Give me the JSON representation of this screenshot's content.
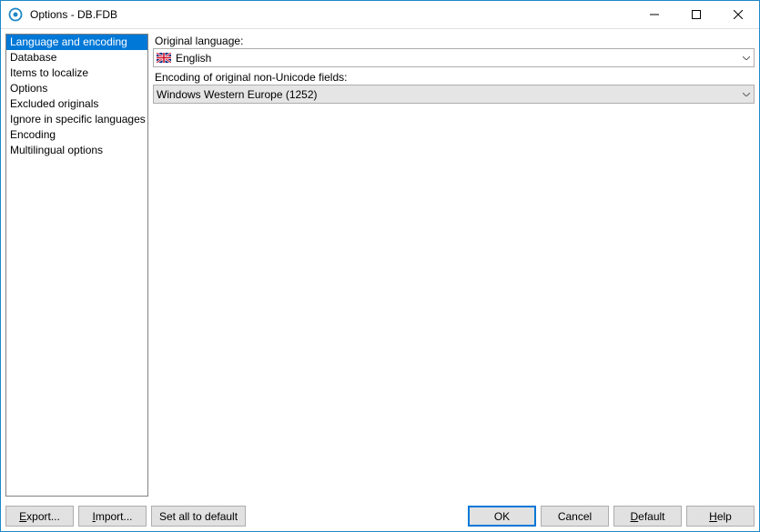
{
  "titlebar": {
    "title": "Options - DB.FDB"
  },
  "sidebar": {
    "items": [
      {
        "label": "Language and encoding",
        "selected": true
      },
      {
        "label": "Database"
      },
      {
        "label": "Items to localize"
      },
      {
        "label": "Options"
      },
      {
        "label": "Excluded originals"
      },
      {
        "label": "Ignore in specific languages"
      },
      {
        "label": "Encoding"
      },
      {
        "label": "Multilingual options"
      }
    ]
  },
  "main": {
    "original_language_label": "Original language:",
    "original_language_value": "English",
    "encoding_label": "Encoding of original non-Unicode fields:",
    "encoding_value": "Windows Western Europe (1252)"
  },
  "footer": {
    "export": "Export...",
    "import": "Import...",
    "set_all": "Set all to default",
    "ok": "OK",
    "cancel": "Cancel",
    "default": "Default",
    "help": "Help"
  }
}
